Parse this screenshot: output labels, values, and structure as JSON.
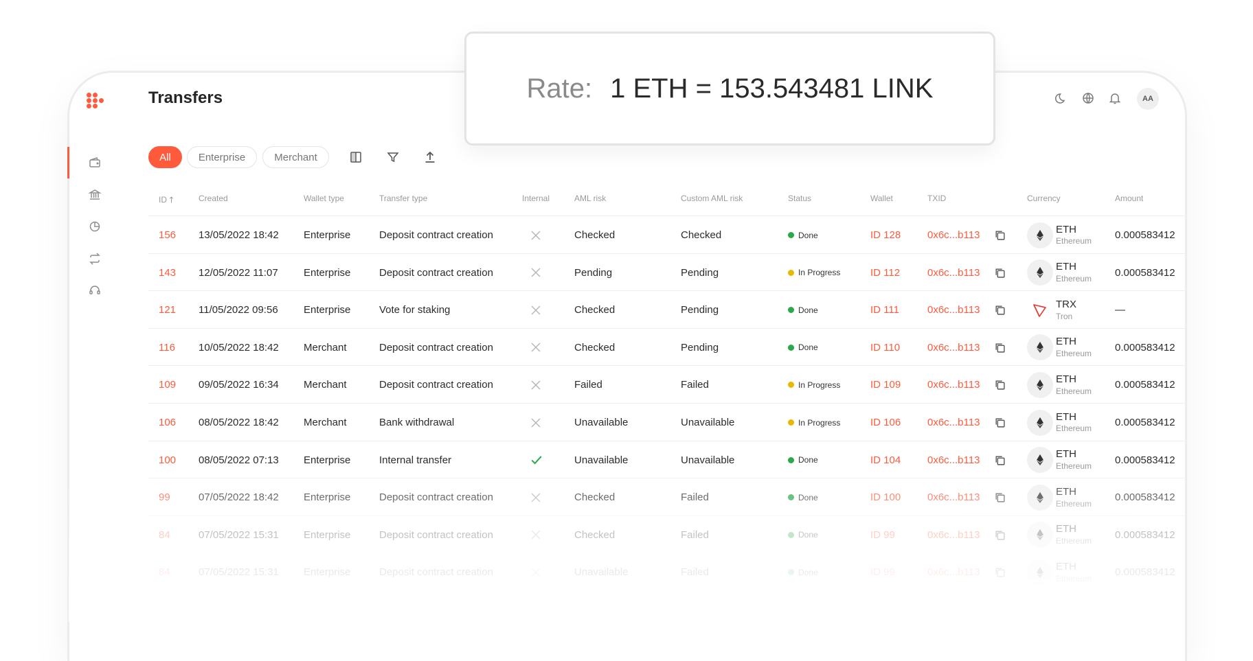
{
  "header": {
    "title": "Transfers",
    "rate_label": "Rate:",
    "rate_value": "1 ETH = 153.543481 LINK",
    "avatar_initials": "AA"
  },
  "filters": [
    "All",
    "Enterprise",
    "Merchant"
  ],
  "colors": {
    "accent": "#ff5a3c",
    "done": "#2aa84a",
    "in_progress": "#e8b800",
    "check": "#2aa84a"
  },
  "table": {
    "columns": [
      "ID",
      "Created",
      "Wallet type",
      "Transfer type",
      "Internal",
      "AML risk",
      "Custom AML risk",
      "Status",
      "Wallet",
      "TXID",
      "Currency",
      "Amount"
    ],
    "rows": [
      {
        "id": "156",
        "created": "13/05/2022 18:42",
        "wallet_type": "Enterprise",
        "transfer_type": "Deposit contract creation",
        "internal": false,
        "aml": "Checked",
        "custom_aml": "Checked",
        "status": "Done",
        "wallet": "ID 128",
        "txid": "0x6c...b113",
        "currency": "ETH",
        "currency_name": "Ethereum",
        "amount": "0.000583412"
      },
      {
        "id": "143",
        "created": "12/05/2022 11:07",
        "wallet_type": "Enterprise",
        "transfer_type": "Deposit contract creation",
        "internal": false,
        "aml": "Pending",
        "custom_aml": "Pending",
        "status": "In Progress",
        "wallet": "ID 112",
        "txid": "0x6c...b113",
        "currency": "ETH",
        "currency_name": "Ethereum",
        "amount": "0.000583412"
      },
      {
        "id": "121",
        "created": "11/05/2022 09:56",
        "wallet_type": "Enterprise",
        "transfer_type": "Vote for staking",
        "internal": false,
        "aml": "Checked",
        "custom_aml": "Pending",
        "status": "Done",
        "wallet": "ID 111",
        "txid": "0x6c...b113",
        "currency": "TRX",
        "currency_name": "Tron",
        "amount": "—"
      },
      {
        "id": "116",
        "created": "10/05/2022 18:42",
        "wallet_type": "Merchant",
        "transfer_type": "Deposit contract creation",
        "internal": false,
        "aml": "Checked",
        "custom_aml": "Pending",
        "status": "Done",
        "wallet": "ID 110",
        "txid": "0x6c...b113",
        "currency": "ETH",
        "currency_name": "Ethereum",
        "amount": "0.000583412"
      },
      {
        "id": "109",
        "created": "09/05/2022 16:34",
        "wallet_type": "Merchant",
        "transfer_type": "Deposit contract creation",
        "internal": false,
        "aml": "Failed",
        "custom_aml": "Failed",
        "status": "In Progress",
        "wallet": "ID 109",
        "txid": "0x6c...b113",
        "currency": "ETH",
        "currency_name": "Ethereum",
        "amount": "0.000583412"
      },
      {
        "id": "106",
        "created": "08/05/2022 18:42",
        "wallet_type": "Merchant",
        "transfer_type": "Bank withdrawal",
        "internal": false,
        "aml": "Unavailable",
        "custom_aml": "Unavailable",
        "status": "In Progress",
        "wallet": "ID 106",
        "txid": "0x6c...b113",
        "currency": "ETH",
        "currency_name": "Ethereum",
        "amount": "0.000583412"
      },
      {
        "id": "100",
        "created": "08/05/2022 07:13",
        "wallet_type": "Enterprise",
        "transfer_type": "Internal transfer",
        "internal": true,
        "aml": "Unavailable",
        "custom_aml": "Unavailable",
        "status": "Done",
        "wallet": "ID 104",
        "txid": "0x6c...b113",
        "currency": "ETH",
        "currency_name": "Ethereum",
        "amount": "0.000583412"
      },
      {
        "id": "99",
        "created": "07/05/2022 18:42",
        "wallet_type": "Enterprise",
        "transfer_type": "Deposit contract creation",
        "internal": false,
        "aml": "Checked",
        "custom_aml": "Failed",
        "status": "Done",
        "wallet": "ID 100",
        "txid": "0x6c...b113",
        "currency": "ETH",
        "currency_name": "Ethereum",
        "amount": "0.000583412"
      },
      {
        "id": "84",
        "created": "07/05/2022 15:31",
        "wallet_type": "Enterprise",
        "transfer_type": "Deposit contract creation",
        "internal": false,
        "aml": "Checked",
        "custom_aml": "Failed",
        "status": "Done",
        "wallet": "ID 99",
        "txid": "0x6c...b113",
        "currency": "ETH",
        "currency_name": "Ethereum",
        "amount": "0.000583412"
      },
      {
        "id": "84",
        "created": "07/05/2022 15:31",
        "wallet_type": "Enterprise",
        "transfer_type": "Deposit contract creation",
        "internal": false,
        "aml": "Unavailable",
        "custom_aml": "Failed",
        "status": "Done",
        "wallet": "ID 99",
        "txid": "0x6c...b113",
        "currency": "ETH",
        "currency_name": "Ethereum",
        "amount": "0.000583412"
      }
    ]
  }
}
